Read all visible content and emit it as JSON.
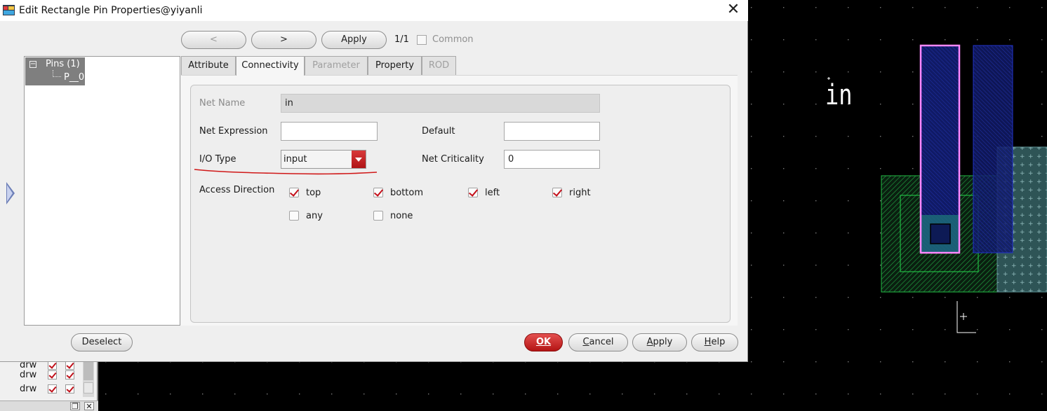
{
  "dialog": {
    "title": "Edit Rectangle Pin Properties@yiyanli",
    "close_glyph": "✕"
  },
  "nav": {
    "prev_label": "<",
    "next_label": ">",
    "apply_label": "Apply",
    "counter": "1/1",
    "common_label": "Common",
    "common_checked": false
  },
  "tree": {
    "root_label": "Pins (1)",
    "child_label": "P__0",
    "expander": "−"
  },
  "tabs": [
    {
      "label": "Attribute",
      "state": "normal"
    },
    {
      "label": "Connectivity",
      "state": "active"
    },
    {
      "label": "Parameter",
      "state": "disabled"
    },
    {
      "label": "Property",
      "state": "normal"
    },
    {
      "label": "ROD",
      "state": "disabled"
    }
  ],
  "connectivity": {
    "net_name_label": "Net Name",
    "net_name_value": "in",
    "net_expression_label": "Net Expression",
    "net_expression_value": "",
    "default_label": "Default",
    "default_value": "",
    "io_type_label": "I/O Type",
    "io_type_value": "input",
    "net_criticality_label": "Net Criticality",
    "net_criticality_value": "0",
    "access_direction_label": "Access Direction",
    "access": {
      "top": {
        "label": "top",
        "checked": true
      },
      "bottom": {
        "label": "bottom",
        "checked": true
      },
      "left": {
        "label": "left",
        "checked": true
      },
      "right": {
        "label": "right",
        "checked": true
      },
      "any": {
        "label": "any",
        "checked": false
      },
      "none": {
        "label": "none",
        "checked": false
      }
    }
  },
  "footer": {
    "deselect_label": "Deselect",
    "ok_label": "OK",
    "cancel_label": "Cancel",
    "apply_label": "Apply",
    "help_label": "Help"
  },
  "layer_palette": {
    "rows": [
      {
        "name": "drw"
      },
      {
        "name": "drw"
      },
      {
        "name": "drw"
      }
    ]
  },
  "layout_canvas": {
    "pin_text": "in",
    "colors": {
      "background": "#000000",
      "metal": "#2233cc",
      "active": "#22bb44",
      "highlight": "#ff88ff",
      "implant": "#5c8f92",
      "annotation_underline": "#d01818"
    }
  }
}
